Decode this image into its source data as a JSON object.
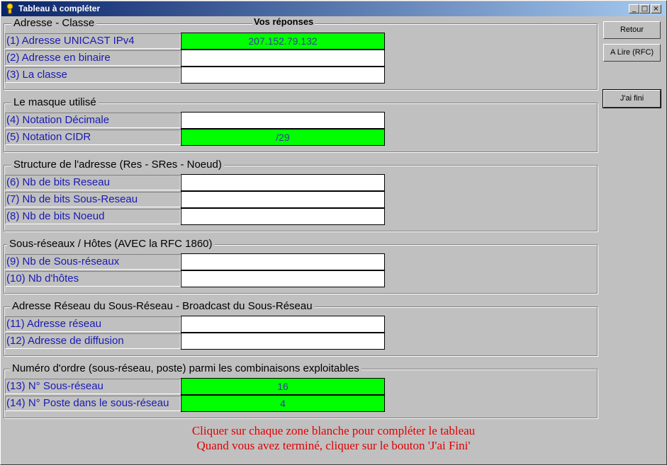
{
  "window": {
    "title": "Tableau à compléter",
    "buttons": [
      "_",
      "□",
      "×"
    ]
  },
  "column_header": "Vos réponses",
  "groups": [
    {
      "title": "Adresse  - Classe",
      "rows": [
        {
          "label": "(1) Adresse UNICAST IPv4",
          "value": "207.152.79.132",
          "filled": true
        },
        {
          "label": "(2) Adresse en binaire",
          "value": "",
          "filled": false
        },
        {
          "label": "(3) La classe",
          "value": "",
          "filled": false
        }
      ]
    },
    {
      "title": "Le masque utilisé",
      "rows": [
        {
          "label": "(4) Notation Décimale",
          "value": "",
          "filled": false
        },
        {
          "label": "(5) Notation CIDR",
          "value": "/29",
          "filled": true
        }
      ]
    },
    {
      "title": "Structure de l'adresse (Res - SRes - Noeud)",
      "rows": [
        {
          "label": "(6) Nb de bits Reseau",
          "value": "",
          "filled": false
        },
        {
          "label": "(7) Nb de bits Sous-Reseau",
          "value": "",
          "filled": false
        },
        {
          "label": "(8) Nb de bits Noeud",
          "value": "",
          "filled": false
        }
      ]
    },
    {
      "title": "Sous-réseaux / Hôtes (AVEC la RFC 1860)",
      "rows": [
        {
          "label": "(9) Nb de Sous-réseaux",
          "value": "",
          "filled": false
        },
        {
          "label": "(10) Nb d'hôtes",
          "value": "",
          "filled": false
        }
      ]
    },
    {
      "title": "Adresse Réseau du Sous-Réseau - Broadcast du Sous-Réseau",
      "rows": [
        {
          "label": "(11) Adresse réseau",
          "value": "",
          "filled": false
        },
        {
          "label": "(12) Adresse de diffusion",
          "value": "",
          "filled": false
        }
      ]
    },
    {
      "title": "Numéro d'ordre (sous-réseau, poste) parmi les combinaisons exploitables",
      "rows": [
        {
          "label": "(13) N° Sous-réseau",
          "value": "16",
          "filled": true
        },
        {
          "label": "(14) N° Poste dans le sous-réseau",
          "value": "4",
          "filled": true
        }
      ]
    }
  ],
  "side_buttons": {
    "retour": "Retour",
    "lire": "A Lire (RFC)",
    "fini": "J'ai fini"
  },
  "instructions": [
    "Cliquer sur chaque zone blanche pour compléter le tableau",
    "Quand vous avez terminé, cliquer sur le bouton 'J'ai Fini'"
  ],
  "colors": {
    "filled": "#00ff00",
    "label_text": "#1a1ab4",
    "instruction_text": "#e00000"
  }
}
